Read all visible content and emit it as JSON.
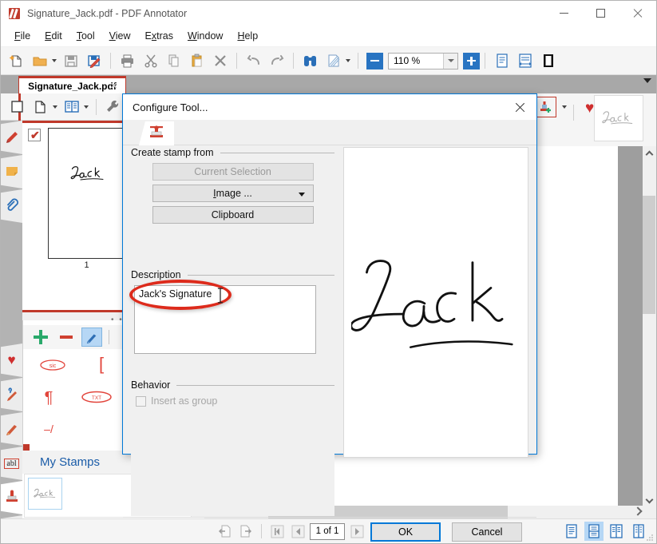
{
  "window": {
    "title": "Signature_Jack.pdf - PDF Annotator",
    "app_icon": "pdf-annotator-logo-icon",
    "minimize_label": "—",
    "maximize_label": "□",
    "close_label": "✕"
  },
  "menu": {
    "items": [
      {
        "label": "File",
        "accel": "F"
      },
      {
        "label": "Edit",
        "accel": "E"
      },
      {
        "label": "Tool",
        "accel": "T"
      },
      {
        "label": "View",
        "accel": "V"
      },
      {
        "label": "Extras",
        "accel": "x"
      },
      {
        "label": "Window",
        "accel": "W"
      },
      {
        "label": "Help",
        "accel": "H"
      }
    ]
  },
  "toolbar": {
    "buttons": [
      {
        "name": "new-document-icon",
        "title": "New"
      },
      {
        "name": "open-folder-icon",
        "title": "Open"
      },
      {
        "name": "open-dropdown-caret-icon",
        "title": "Open options"
      },
      {
        "name": "save-icon",
        "title": "Save"
      },
      {
        "name": "save-as-icon",
        "title": "Save As"
      },
      {
        "name": "print-icon",
        "title": "Print"
      },
      {
        "name": "cut-scissors-icon",
        "title": "Cut"
      },
      {
        "name": "copy-icon",
        "title": "Copy"
      },
      {
        "name": "paste-clipboard-icon",
        "title": "Paste"
      },
      {
        "name": "delete-x-icon",
        "title": "Delete"
      },
      {
        "name": "undo-arrow-icon",
        "title": "Undo"
      },
      {
        "name": "redo-arrow-icon",
        "title": "Redo"
      },
      {
        "name": "find-binoculars-icon",
        "title": "Find"
      },
      {
        "name": "erase-page-icon",
        "title": "Erase"
      },
      {
        "name": "erase-dropdown-caret-icon",
        "title": "Erase options"
      }
    ],
    "zoom": {
      "value": "110 %",
      "zoom_out_name": "zoom-out-button",
      "zoom_in_name": "zoom-in-button",
      "dropdown_name": "zoom-dropdown"
    },
    "view_buttons": [
      {
        "name": "page-view-icon",
        "title": "Page view"
      },
      {
        "name": "page-width-icon",
        "title": "Fit width"
      },
      {
        "name": "full-page-icon",
        "title": "Full page"
      }
    ]
  },
  "tabs": {
    "document_tab": "Signature_Jack.pdf",
    "close_glyph": "✕",
    "overflow_name": "tab-overflow-button"
  },
  "toolbar2": {
    "buttons": [
      {
        "name": "select-rectangle-icon"
      },
      {
        "name": "page-tool-icon"
      },
      {
        "name": "page-tool-caret-icon"
      },
      {
        "name": "book-view-icon"
      },
      {
        "name": "book-view-caret-icon"
      },
      {
        "name": "wrench-settings-icon"
      },
      {
        "name": "wrench-caret-icon"
      },
      {
        "name": "add-stamp-icon"
      },
      {
        "name": "add-stamp-caret-icon"
      },
      {
        "name": "favorite-heart-icon"
      },
      {
        "name": "favorite-heart-caret-icon"
      },
      {
        "name": "toolbar-expand-chevron-icon"
      }
    ],
    "stamp_preview_label": "Jack"
  },
  "left_rail": {
    "tabs": [
      {
        "name": "bookmarks-tab",
        "icon": "bookmark-ribbon-icon",
        "active": false
      },
      {
        "name": "notes-tab",
        "icon": "sticky-note-icon",
        "active": false
      },
      {
        "name": "attachments-tab",
        "icon": "paperclip-icon",
        "active": false
      },
      {
        "name": "favorites-tab",
        "icon": "heart-icon",
        "active": false
      },
      {
        "name": "pen-tool-tab",
        "icon": "blue-pen-icon",
        "active": false
      },
      {
        "name": "pencil-tool-tab",
        "icon": "pencil-icon",
        "active": false
      },
      {
        "name": "text-tool-tab",
        "icon": "abl-text-icon",
        "active": false
      },
      {
        "name": "stamps-tab",
        "icon": "stamp-icon",
        "active": true
      },
      {
        "name": "pointer-tool-tab",
        "icon": "arrow-pointer-icon",
        "active": false
      }
    ],
    "text_tool_label": "abl"
  },
  "thumbnails": {
    "checkbox_checked": true,
    "check_glyph": "✔",
    "page_label": "1",
    "signature_text": "Jack"
  },
  "palette": {
    "grip_dots": "• • • • •",
    "tools": [
      {
        "name": "add-stamp-plus-icon",
        "glyph": "+",
        "color": "#2aa96b",
        "selected": false
      },
      {
        "name": "remove-stamp-minus-icon",
        "glyph": "−",
        "color": "#cf4030",
        "selected": false
      },
      {
        "name": "edit-stamp-pen-icon",
        "glyph": "pen",
        "color": "#2f6fb5",
        "selected": true
      },
      {
        "name": "favorite-stamp-heart-icon",
        "glyph": "♥",
        "color": "#cf2f2f",
        "selected": false
      }
    ],
    "stamps": [
      {
        "name": "stamp-sic",
        "label": "sic"
      },
      {
        "name": "stamp-bracket-open",
        "label": "["
      },
      {
        "name": "stamp-bracket-close",
        "label": "]"
      },
      {
        "name": "stamp-paragraph",
        "label": "¶"
      },
      {
        "name": "stamp-oval-text",
        "label": "TXT"
      },
      {
        "name": "stamp-circle-plus",
        "label": "⊕"
      },
      {
        "name": "stamp-slash",
        "label": "–/"
      }
    ]
  },
  "my_stamps": {
    "title": "My Stamps",
    "collapse_name": "my-stamps-collapse-chevron",
    "items": [
      {
        "name": "my-stamp-jack",
        "label": "Jack"
      }
    ]
  },
  "status_bar": {
    "buttons": [
      {
        "name": "previous-view-icon"
      },
      {
        "name": "next-view-icon"
      },
      {
        "name": "first-page-icon",
        "glyph": "⏮"
      },
      {
        "name": "previous-page-icon",
        "glyph": "◀"
      },
      {
        "name": "next-page-icon",
        "glyph": "▶"
      },
      {
        "name": "last-page-icon",
        "glyph": "⏭"
      },
      {
        "name": "back-navigation-icon"
      },
      {
        "name": "forward-navigation-icon"
      }
    ],
    "page_indicator": "1 of 1",
    "view_modes": [
      {
        "name": "single-page-view-icon",
        "selected": false
      },
      {
        "name": "continuous-view-icon",
        "selected": true
      },
      {
        "name": "facing-pages-view-icon",
        "selected": false
      },
      {
        "name": "grid-view-icon",
        "selected": false
      }
    ]
  },
  "dialog": {
    "title": "Configure Tool...",
    "close_name": "dialog-close-button",
    "tab_icon": "stamp-tab-icon",
    "create_stamp_from": {
      "group_label": "Create stamp from",
      "buttons": [
        {
          "name": "current-selection-button",
          "label": "Current Selection",
          "disabled": true
        },
        {
          "name": "image-button",
          "label": "Image ...",
          "disabled": false,
          "has_dropdown": true
        },
        {
          "name": "clipboard-button",
          "label": "Clipboard",
          "disabled": false,
          "has_dropdown": false
        }
      ]
    },
    "description": {
      "group_label": "Description",
      "value": "Jack's Signature",
      "annotation": "red-ellipse-highlight"
    },
    "behavior": {
      "group_label": "Behavior",
      "checkbox_label": "Insert as group",
      "checked": false,
      "disabled": true
    },
    "preview": {
      "name": "signature-preview",
      "alt": "Jack"
    },
    "ok_label": "OK",
    "cancel_label": "Cancel"
  },
  "colors": {
    "accent_blue": "#0078d7",
    "brand_red": "#c0392b",
    "annotation_red": "#dd2b1c",
    "link_blue": "#1a5ca8",
    "selection_blue": "#b6d7f5"
  }
}
